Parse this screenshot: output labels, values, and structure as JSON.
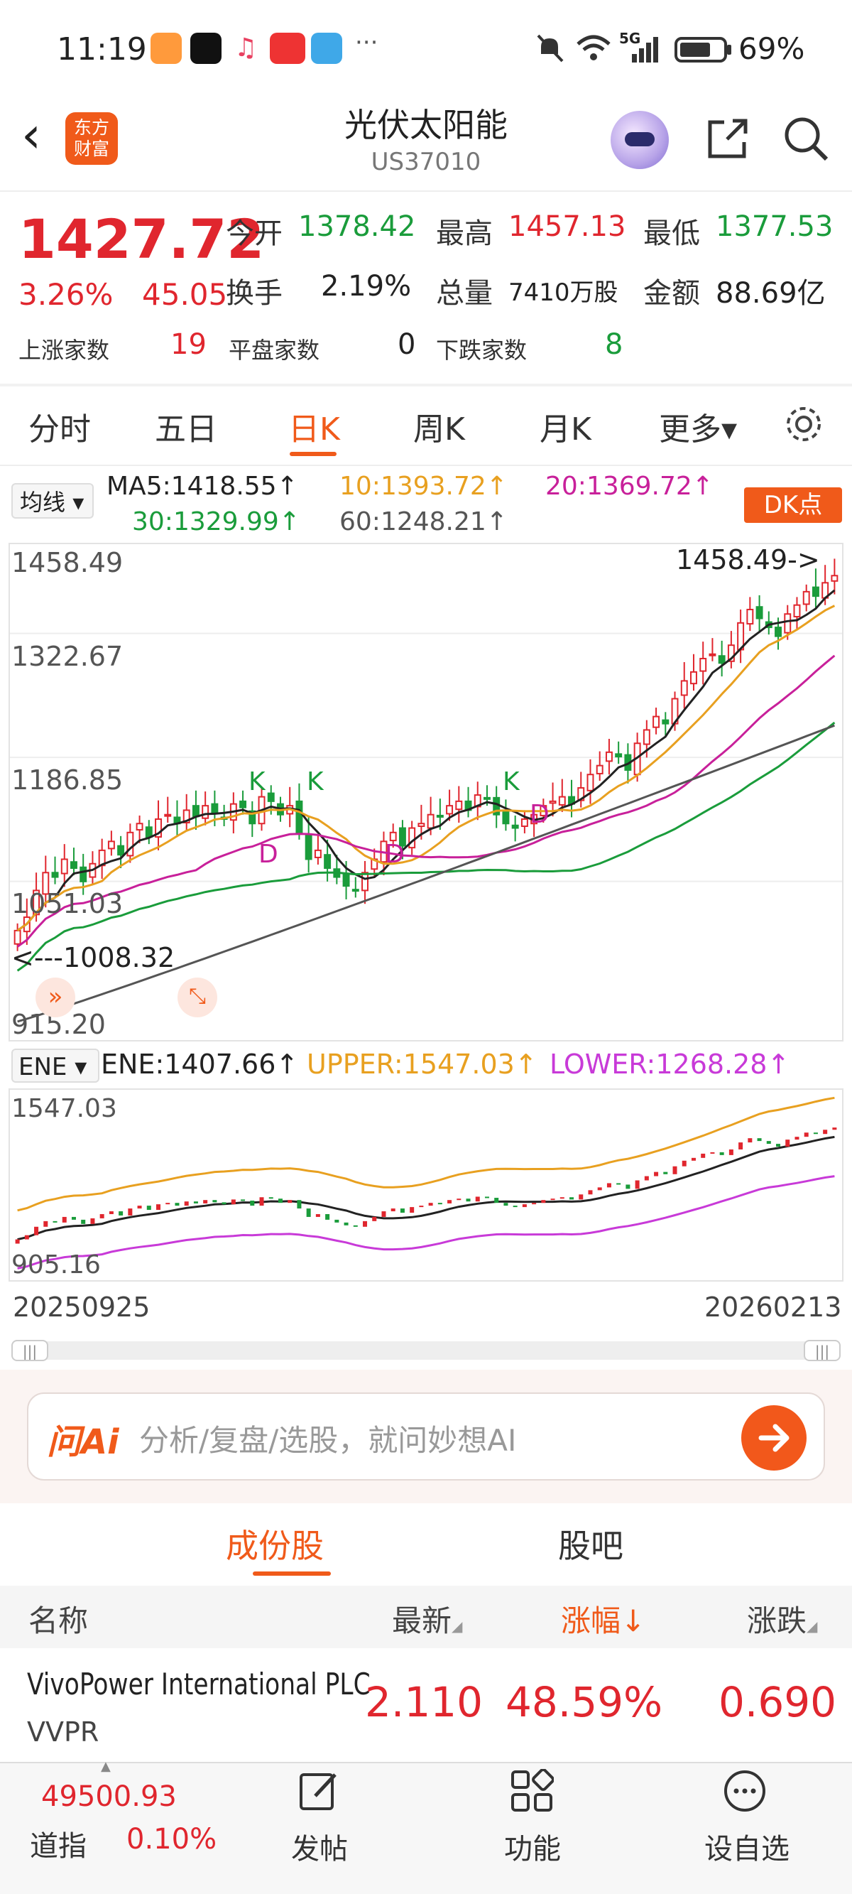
{
  "status_bar": {
    "time": "11:19",
    "signal": "5G",
    "battery": "69%"
  },
  "header": {
    "logo_text": "东方财富",
    "title": "光伏太阳能",
    "subtitle": "US37010"
  },
  "quote": {
    "price": "1427.72",
    "change_pct": "3.26%",
    "change_amt": "45.05",
    "open_label": "今开",
    "open": "1378.42",
    "high_label": "最高",
    "high": "1457.13",
    "low_label": "最低",
    "low": "1377.53",
    "turnover_label": "换手",
    "turnover": "2.19%",
    "volume_label": "总量",
    "volume": "7410万股",
    "amount_label": "金额",
    "amount": "88.69亿",
    "up_label": "上涨家数",
    "up": "19",
    "flat_label": "平盘家数",
    "flat": "0",
    "down_label": "下跌家数",
    "down": "8"
  },
  "period_tabs": [
    "分时",
    "五日",
    "日K",
    "周K",
    "月K",
    "更多▾"
  ],
  "active_tab": "日K",
  "ma_bar": {
    "select": "均线",
    "ma5": "MA5:1418.55↑",
    "ma10": "10:1393.72↑",
    "ma20": "20:1369.72↑",
    "ma30": "30:1329.99↑",
    "ma60": "60:1248.21↑",
    "dk_button": "DK点"
  },
  "colors": {
    "accent": "#f05a1a",
    "up": "#e0262e",
    "down": "#1a9c3b",
    "ma5": "#222222",
    "ma10": "#e8a020",
    "ma20": "#c8209a",
    "ma30": "#1a9c3b",
    "ma60": "#555555"
  },
  "chart_data": [
    {
      "type": "candlestick",
      "y_ticks": [
        "1458.49",
        "1322.67",
        "1186.85",
        "1051.03",
        "915.20"
      ],
      "ylim": [
        915.2,
        1458.49
      ],
      "annotations": {
        "high_marker": "1458.49->",
        "low_marker": "<---1008.32",
        "signals": [
          "K",
          "K",
          "K",
          "D",
          "D",
          "D"
        ]
      },
      "closes": [
        1030,
        1045,
        1075,
        1095,
        1090,
        1110,
        1100,
        1085,
        1105,
        1120,
        1130,
        1115,
        1140,
        1150,
        1135,
        1155,
        1160,
        1150,
        1165,
        1158,
        1170,
        1162,
        1155,
        1172,
        1168,
        1150,
        1180,
        1175,
        1160,
        1170,
        1140,
        1110,
        1120,
        1100,
        1090,
        1080,
        1075,
        1095,
        1110,
        1130,
        1140,
        1125,
        1145,
        1150,
        1160,
        1158,
        1170,
        1175,
        1165,
        1182,
        1178,
        1160,
        1150,
        1145,
        1155,
        1160,
        1170,
        1175,
        1180,
        1172,
        1190,
        1205,
        1215,
        1230,
        1225,
        1210,
        1240,
        1255,
        1270,
        1262,
        1290,
        1310,
        1320,
        1335,
        1340,
        1330,
        1350,
        1375,
        1390,
        1380,
        1370,
        1360,
        1385,
        1395,
        1410,
        1405,
        1420,
        1428
      ],
      "ma60_range": [
        928,
        1260
      ]
    },
    {
      "type": "line",
      "indicator": "ENE",
      "select": "ENE",
      "ene": "ENE:1407.66↑",
      "upper": "UPPER:1547.03↑",
      "lower": "LOWER:1268.28↑",
      "y_ticks": [
        "1547.03",
        "905.16"
      ],
      "ylim": [
        905.16,
        1547.03
      ],
      "x_start": "20250925",
      "x_end": "20260213"
    }
  ],
  "ask_ai": {
    "logo": "问Ai",
    "placeholder": "分析/复盘/选股，就问妙想AI"
  },
  "content_tabs": [
    "成份股",
    "股吧"
  ],
  "table": {
    "headers": [
      "名称",
      "最新",
      "涨幅↓",
      "涨跌"
    ],
    "rows": [
      {
        "name": "VivoPower International PLC",
        "code": "VVPR",
        "last": "2.110",
        "pct": "48.59%",
        "chg": "0.690"
      }
    ]
  },
  "bottom_nav": {
    "index_value": "49500.93",
    "index_name": "道指",
    "index_pct": "0.10%",
    "items": [
      "发帖",
      "功能",
      "设自选"
    ]
  }
}
